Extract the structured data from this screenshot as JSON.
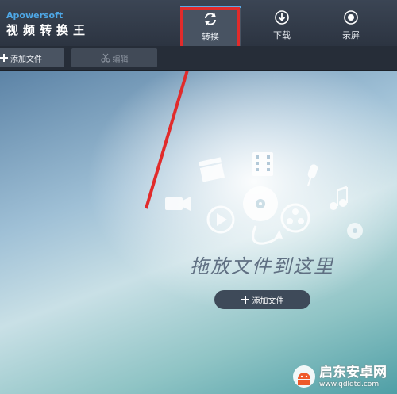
{
  "app": {
    "brand_en": "Apowersoft",
    "brand_cn": "视频转换王"
  },
  "tabs": [
    {
      "label": "转换",
      "icon": "refresh-icon",
      "active": true
    },
    {
      "label": "下载",
      "icon": "download-icon",
      "active": false
    },
    {
      "label": "录屏",
      "icon": "record-icon",
      "active": false
    }
  ],
  "toolbar": {
    "add_file_label": "添加文件",
    "edit_label": "编辑"
  },
  "main": {
    "drop_text": "拖放文件到这里",
    "add_file_label": "添加文件"
  },
  "watermark": {
    "line1": "启东安卓网",
    "line2": "www.qdldtd.com"
  },
  "colors": {
    "accent": "#4ea7e6",
    "highlight": "#e12b2b",
    "topbar": "#333c4a"
  }
}
